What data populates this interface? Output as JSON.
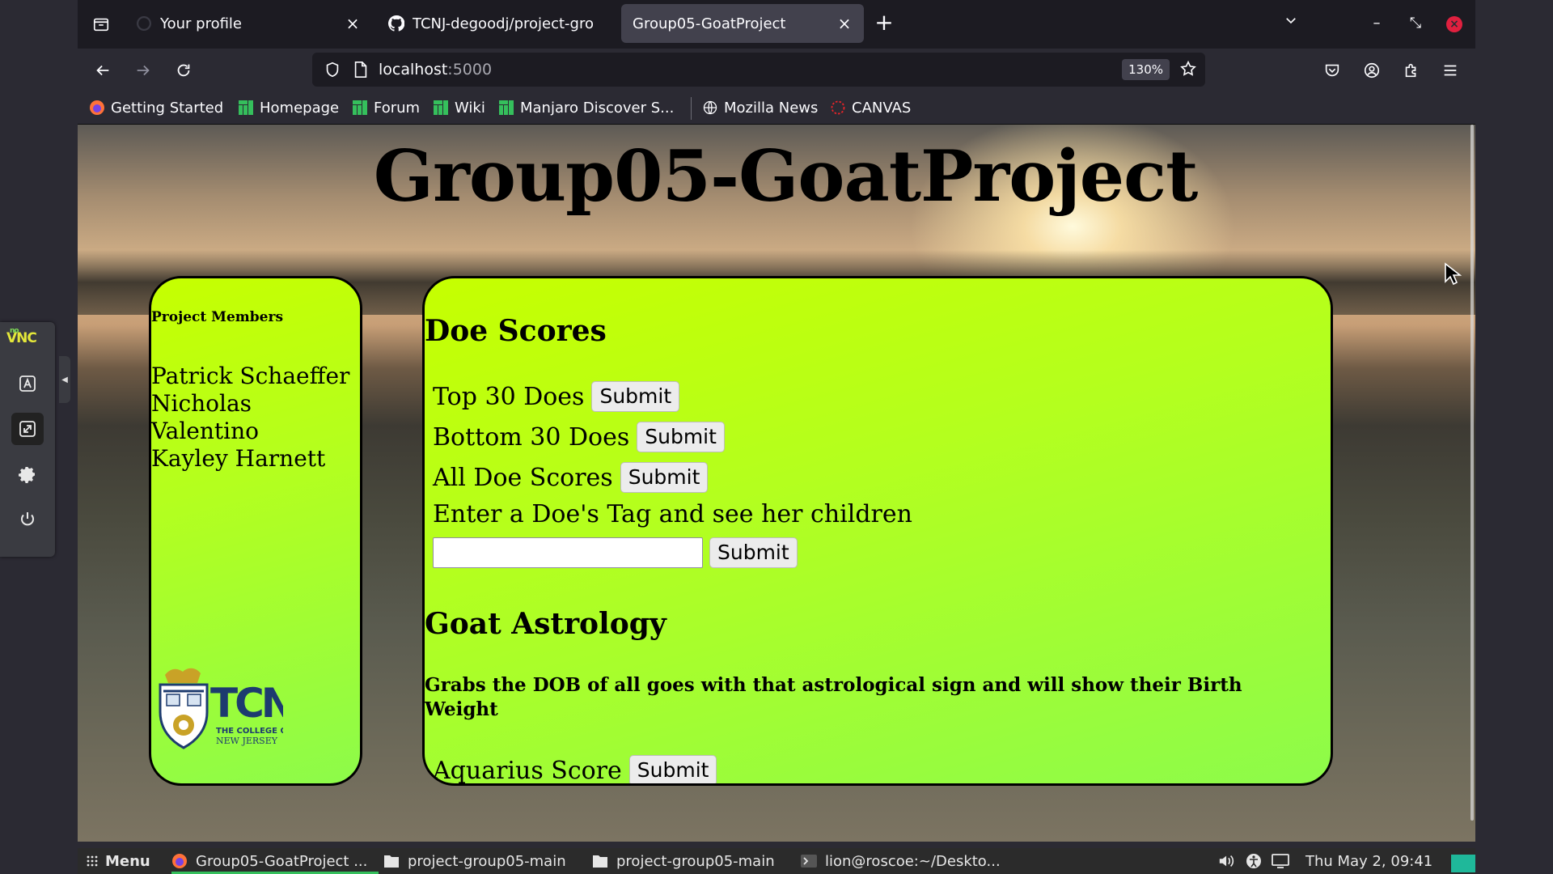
{
  "vnc": {
    "logo_top": "no",
    "logo_main": "VNC"
  },
  "browser": {
    "tabs": [
      {
        "title": "Your profile",
        "close": "×"
      },
      {
        "title": "TCNJ-degoodj/project-gro",
        "close": "×"
      },
      {
        "title": "Group05-GoatProject",
        "close": "×"
      }
    ],
    "new_tab": "+",
    "url_host": "localhost",
    "url_port": ":5000",
    "zoom": "130%",
    "bookmarks": [
      "Getting Started",
      "Homepage",
      "Forum",
      "Wiki",
      "Manjaro Discover S...",
      "Mozilla News",
      "CANVAS"
    ]
  },
  "page": {
    "title": "Group05-GoatProject",
    "members": {
      "heading": "Project Members",
      "names": [
        "Patrick Schaeffer",
        "Nicholas",
        "Valentino",
        "Kayley Harnett"
      ]
    },
    "logo": {
      "name": "TCNJ",
      "line1": "THE COLLEGE OF",
      "line2": "NEW JERSEY"
    },
    "doe_scores": {
      "heading": "Doe Scores",
      "top30": "Top 30 Does",
      "bottom30": "Bottom 30 Does",
      "all": "All Doe Scores",
      "tag_prompt": "Enter a Doe's Tag and see her children",
      "tag_value": "",
      "submit": "Submit"
    },
    "astrology": {
      "heading": "Goat Astrology",
      "description": "Grabs the DOB of all goes with that astrological sign and will show their Birth Weight",
      "aquarius": "Aquarius Score",
      "submit": "Submit"
    }
  },
  "taskbar": {
    "menu": "Menu",
    "items": [
      "Group05-GoatProject ...",
      "project-group05-main",
      "project-group05-main",
      "lion@roscoe:~/Deskto..."
    ],
    "clock": "Thu May  2, 09:41"
  },
  "colors": {
    "card_top": "#c6ff00",
    "card_bottom": "#8dfb4a",
    "taskbar_accent": "#35bf5c"
  }
}
